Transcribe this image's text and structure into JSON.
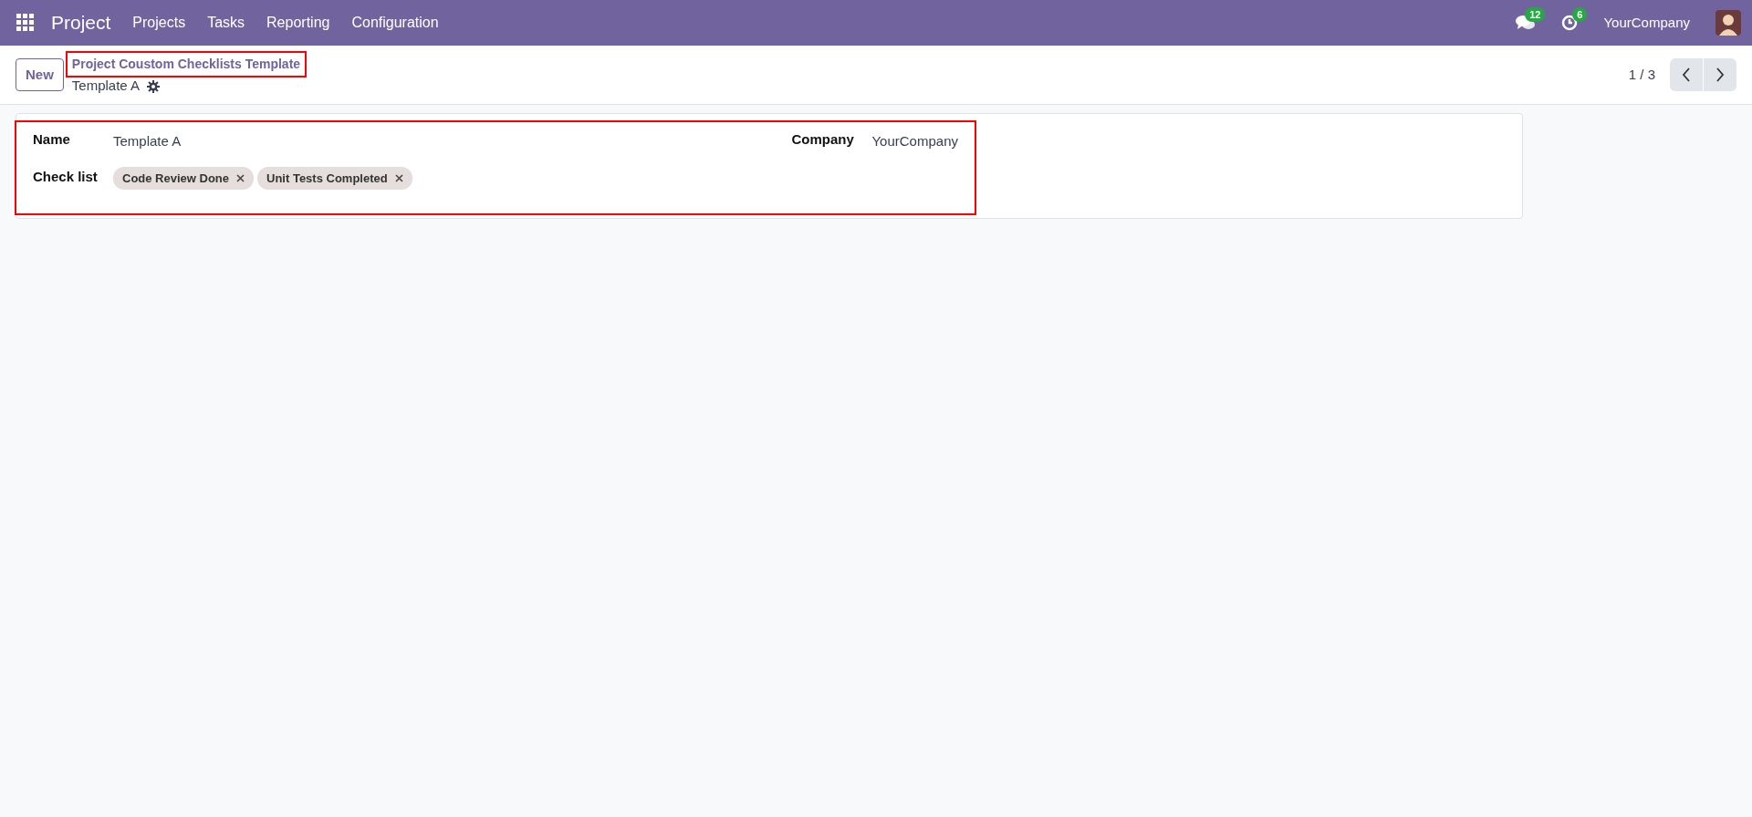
{
  "navbar": {
    "app_name": "Project",
    "menu": [
      "Projects",
      "Tasks",
      "Reporting",
      "Configuration"
    ],
    "messages_count": "12",
    "activities_count": "6",
    "company": "YourCompany"
  },
  "control_panel": {
    "new_button": "New",
    "breadcrumb": "Project Coustom Checklists Template",
    "record_name": "Template A",
    "pager": "1 / 3",
    "highlighted": true
  },
  "form": {
    "highlighted": true,
    "fields": [
      {
        "kind": "text",
        "label": "Name",
        "value": "Template A"
      },
      {
        "kind": "tags",
        "label": "Check list",
        "tags": [
          "Code Review Done",
          "Unit Tests Completed"
        ]
      }
    ],
    "side_fields": [
      {
        "kind": "text",
        "label": "Company",
        "value": "YourCompany"
      }
    ]
  }
}
